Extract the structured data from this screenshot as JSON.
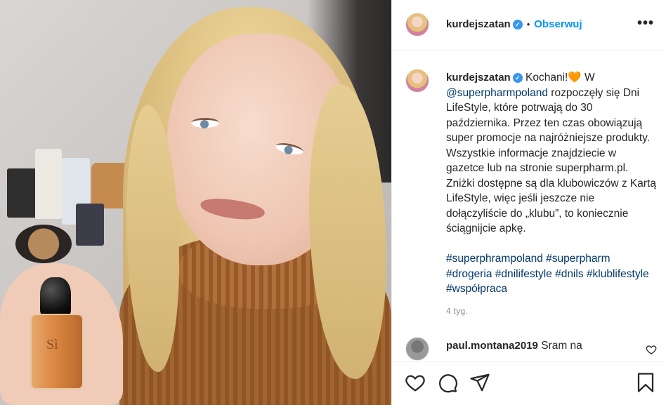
{
  "post": {
    "username": "kurdejszatan",
    "verified_mark": "✓",
    "dot": "•",
    "follow_label": "Obserwuj",
    "more_label": "•••"
  },
  "caption": {
    "username": "kurdejszatan",
    "verified_mark": "✓",
    "text_start": "Kochani!",
    "emoji": "🧡",
    "text_w": " W ",
    "mention": "@superpharmpoland",
    "text_body": " rozpoczęły się Dni LifeStyle, które potrwają do 30 października. Przez ten czas obowiązują super promocje na najróżniejsze produkty. Wszystkie informacje znajdziecie w gazetce lub na stronie superpharm.pl. Zniżki dostępne są dla klubowiczów z Kartą LifeStyle, więc jeśli jeszcze nie dołączyliście do „klubu”, to koniecznie ściągnijcie apkę.",
    "hashtags": "#superphrampoland #superpharm #drogeria #dnilifestyle #dnils #klublifestyle #współpraca",
    "time": "4 tyg."
  },
  "comment2": {
    "username": "paul.montana2019",
    "text": " Sram na"
  },
  "photo": {
    "bottle_label": "Sì"
  },
  "icons": {
    "like": "heart-icon",
    "comment": "comment-icon",
    "share": "share-icon",
    "save": "bookmark-icon"
  },
  "colors": {
    "link": "#00376b",
    "follow": "#0095f6",
    "verified": "#3897f0",
    "muted": "#8e8e8e"
  }
}
